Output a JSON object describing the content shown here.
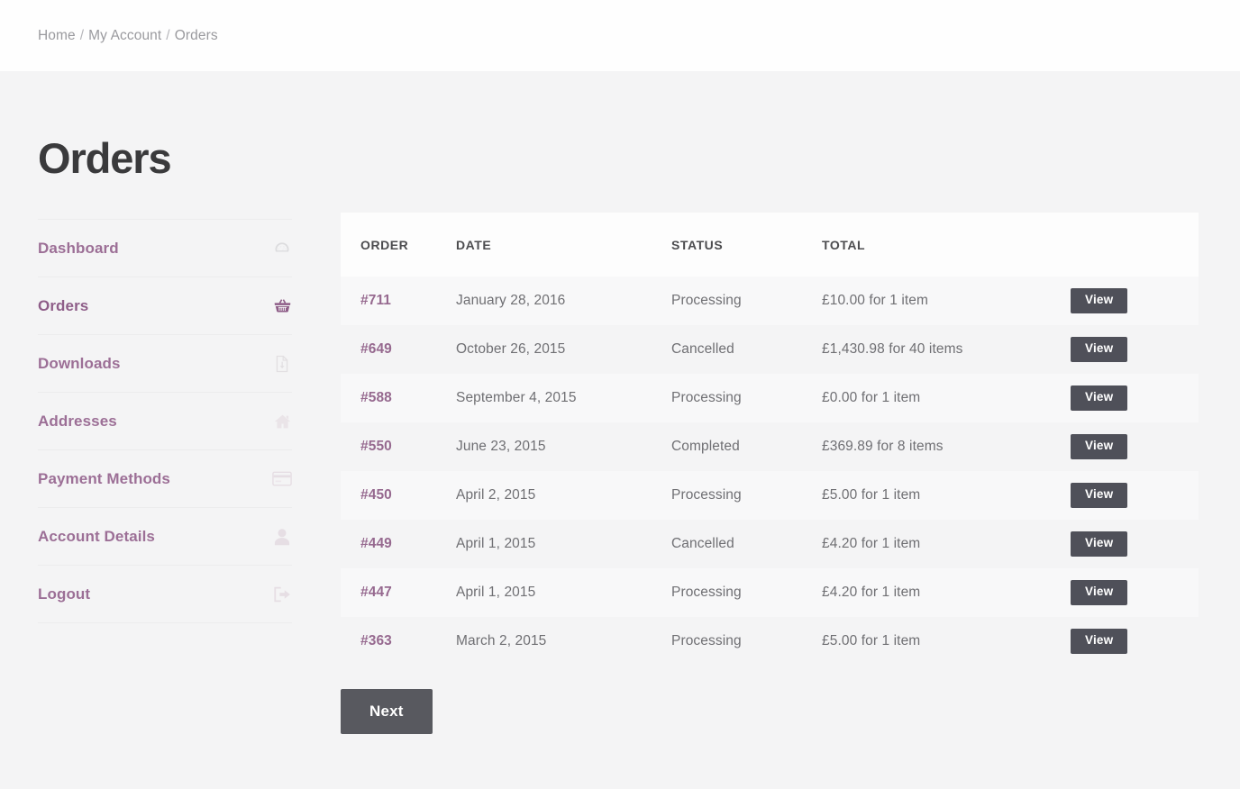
{
  "breadcrumb": {
    "items": [
      "Home",
      "My Account",
      "Orders"
    ],
    "separator": "/"
  },
  "page": {
    "title": "Orders"
  },
  "sidebar": {
    "items": [
      {
        "label": "Dashboard",
        "icon": "dashboard-gauge-icon",
        "active": false
      },
      {
        "label": "Orders",
        "icon": "shopping-basket-icon",
        "active": true
      },
      {
        "label": "Downloads",
        "icon": "file-download-icon",
        "active": false
      },
      {
        "label": "Addresses",
        "icon": "home-icon",
        "active": false
      },
      {
        "label": "Payment Methods",
        "icon": "credit-card-icon",
        "active": false
      },
      {
        "label": "Account Details",
        "icon": "user-icon",
        "active": false
      },
      {
        "label": "Logout",
        "icon": "sign-out-icon",
        "active": false
      }
    ]
  },
  "orders_table": {
    "columns": [
      "ORDER",
      "DATE",
      "STATUS",
      "TOTAL",
      ""
    ],
    "action_label": "View",
    "rows": [
      {
        "order": "#711",
        "date": "January 28, 2016",
        "status": "Processing",
        "total": "£10.00 for 1 item"
      },
      {
        "order": "#649",
        "date": "October 26, 2015",
        "status": "Cancelled",
        "total": "£1,430.98 for 40 items"
      },
      {
        "order": "#588",
        "date": "September 4, 2015",
        "status": "Processing",
        "total": "£0.00 for 1 item"
      },
      {
        "order": "#550",
        "date": "June 23, 2015",
        "status": "Completed",
        "total": "£369.89 for 8 items"
      },
      {
        "order": "#450",
        "date": "April 2, 2015",
        "status": "Processing",
        "total": "£5.00 for 1 item"
      },
      {
        "order": "#449",
        "date": "April 1, 2015",
        "status": "Cancelled",
        "total": "£4.20 for 1 item"
      },
      {
        "order": "#447",
        "date": "April 1, 2015",
        "status": "Processing",
        "total": "£4.20 for 1 item"
      },
      {
        "order": "#363",
        "date": "March 2, 2015",
        "status": "Processing",
        "total": "£5.00 for 1 item"
      }
    ]
  },
  "pagination": {
    "next_label": "Next"
  },
  "colors": {
    "accent_link": "#96698f",
    "sidebar_label": "#9c6f96",
    "button_dark": "#4f5059",
    "next_button": "#58595f",
    "page_background": "#f4f4f5",
    "header_background": "#fdfdfd",
    "title_text": "#3a3a3c",
    "body_text": "#6f6f73",
    "breadcrumb_text": "#9a9a9e"
  }
}
